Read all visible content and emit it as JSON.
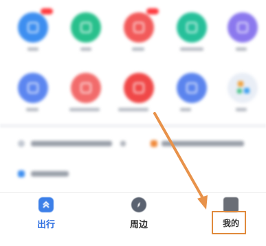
{
  "apps_row1": [
    {
      "color": "#3d8ef0",
      "badge": true
    },
    {
      "color": "#28c08c",
      "badge": false
    },
    {
      "color": "#f25a5a",
      "badge": true
    },
    {
      "color": "#26c09a",
      "badge": false
    },
    {
      "color": "#8b78ee",
      "badge": false
    }
  ],
  "apps_row2": [
    {
      "color": "#5c86f0",
      "badge": false
    },
    {
      "color": "#f26b6b",
      "badge": false
    },
    {
      "color": "#f04848",
      "badge": false
    },
    {
      "color": "#5b84ee",
      "badge": false
    },
    {
      "color": "#e9eef6",
      "badge": false
    }
  ],
  "tabbar": {
    "tabs": [
      {
        "label": "出行",
        "icon": "chevron-up-icon",
        "color": "#2f6fe0",
        "active": true
      },
      {
        "label": "周边",
        "icon": "compass-icon",
        "color": "#5a6270",
        "active": false
      },
      {
        "label": "我的",
        "icon": "profile-icon",
        "color": "#333333",
        "active": false
      }
    ]
  },
  "annotation": {
    "color": "#e08a3c"
  }
}
